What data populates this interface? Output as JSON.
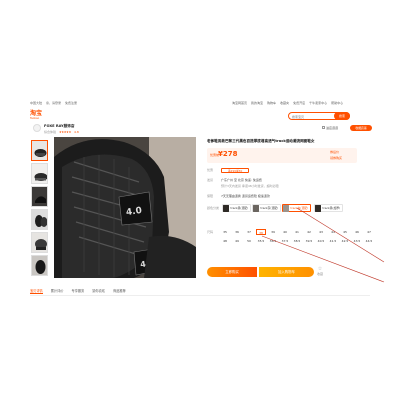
{
  "topnav": {
    "left_items": [
      "中国大陆",
      "亲，请登录",
      "免费注册",
      "手机逛淘宝"
    ],
    "right_items": [
      "淘宝网首页",
      "我的淘宝",
      "购物车",
      "收藏夹",
      "免费开店",
      "千牛卖家中心",
      "帮助中心"
    ]
  },
  "header": {
    "logo_cn": "淘宝",
    "logo_en": "Taobao",
    "search_placeholder": "搜索宝贝",
    "search_button": "搜索",
    "shop_button": "进店逛逛",
    "fav_button": "收藏店铺"
  },
  "shop": {
    "name": "FOXE RAY服饰店",
    "rating_label": "综合体验",
    "stars": "★★★★★",
    "score": "4.8"
  },
  "product": {
    "title": "老爹鞋男款巴黎三代黑色百搭厚底增高透气track运动潮流网面鞋女",
    "price_label": "优惠前",
    "price": "¥278",
    "price_note": "券后价",
    "price_tag": "领券购买",
    "rows": [
      {
        "label": "优惠",
        "value": "满299减30"
      },
      {
        "label": "发货",
        "value": "广东广州 至 北京  快递: 免运费"
      },
      {
        "label": "",
        "value": "预计3天内发货  承诺48小时发货，超时必赔"
      },
      {
        "label": "保障",
        "value": "7天无理由退换  退货运费险  极速退款"
      }
    ],
    "coupon": "满299减30",
    "color_label": "颜色分类",
    "colors": [
      "track黑(顶配)",
      "track灰(顶配)",
      "track白(顶配)",
      "track黑(加厚)"
    ],
    "size_label": "尺码",
    "sizes": [
      "35",
      "36",
      "37",
      "38",
      "39",
      "40",
      "41",
      "42",
      "43",
      "44",
      "45",
      "46",
      "47",
      "48",
      "49",
      "50",
      "35.5",
      "36.5",
      "37.5",
      "38.5",
      "39.5",
      "40.5",
      "41.5",
      "42.5",
      "43.5",
      "44.5"
    ],
    "buy_button": "立即购买",
    "cart_button": "加入购物车",
    "fav_label": "收藏"
  },
  "tabs": [
    "宝贝详情",
    "累计评价",
    "专享服务",
    "猜你喜欢",
    "商品推荐"
  ],
  "colors": {
    "accent": "#ff5000",
    "annotation": "#c0392b"
  }
}
